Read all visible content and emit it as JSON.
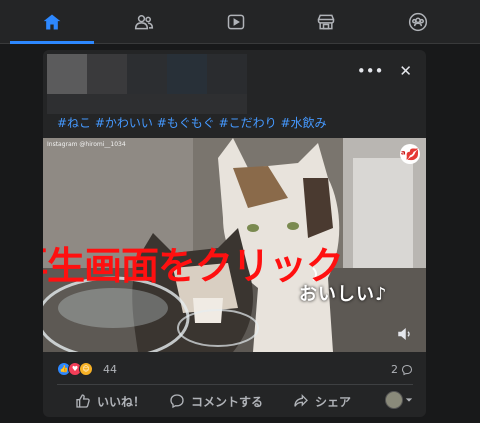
{
  "nav": {
    "items": [
      {
        "name": "home",
        "active": true
      },
      {
        "name": "friends",
        "active": false
      },
      {
        "name": "watch",
        "active": false
      },
      {
        "name": "marketplace",
        "active": false
      },
      {
        "name": "groups",
        "active": false
      }
    ]
  },
  "post": {
    "more_label": "•••",
    "close_label": "✕",
    "hashtags": "#ねこ #かわいい #もぐもぐ #こだわり #水飲み",
    "video": {
      "watermark": "Instagram @hiromi__1034",
      "logo": "ᵃ💋",
      "caption": "おいしい♪",
      "overlay_text": "再生画面をクリック"
    },
    "reactions": {
      "icons": [
        "like-icon",
        "love-icon",
        "care-icon"
      ],
      "count": "44"
    },
    "comments_count": "2",
    "actions": {
      "like_label": "いいね！",
      "comment_label": "コメントする",
      "share_label": "シェア"
    }
  },
  "colors": {
    "accent": "#2d88ff",
    "overlay_red": "#ff1010",
    "hashtag": "#4599ff",
    "background": "#18191a",
    "card": "#242526"
  }
}
